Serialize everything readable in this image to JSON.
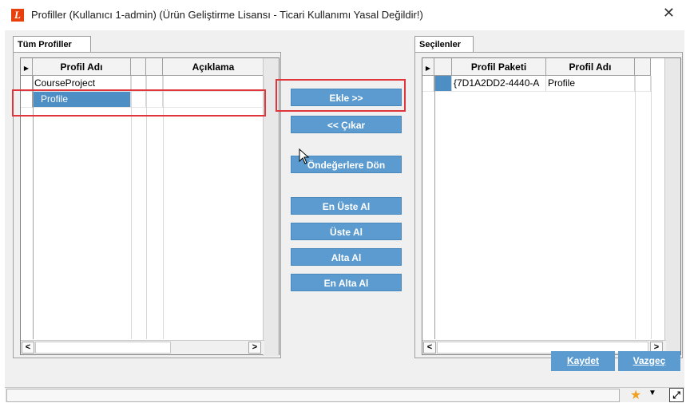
{
  "window": {
    "app_icon_letter": "L",
    "title": "Profiller (Kullanıcı 1-admin) (Ürün Geliştirme Lisansı - Ticari Kullanımı Yasal Değildir!)",
    "close_glyph": "✕"
  },
  "left_panel": {
    "tab_label": "Tüm Profiller",
    "columns": [
      "Profil Adı",
      "Açıklama"
    ],
    "rows": [
      {
        "name": "CourseProject",
        "description": ""
      },
      {
        "name": "Profile",
        "description": "",
        "selected": true
      }
    ]
  },
  "right_panel": {
    "tab_label": "Seçilenler",
    "columns": [
      "Profil Paketi",
      "Profil Adı"
    ],
    "rows": [
      {
        "package": "{7D1A2DD2-4440-A",
        "name": "Profile"
      }
    ]
  },
  "actions": {
    "add": "Ekle >>",
    "remove": "<< Çıkar",
    "reset": "Öndeğerlere Dön",
    "move_top": "En Üste Al",
    "move_up": "Üste Al",
    "move_down": "Alta Al",
    "move_bottom": "En Alta Al"
  },
  "footer": {
    "save": "Kaydet",
    "cancel": "Vazgeç"
  },
  "colors": {
    "button_blue": "#5b9bd0",
    "selection_blue": "#4d8ec4",
    "highlight_red": "#e0363b",
    "app_icon_orange": "#e8400c"
  },
  "icons": {
    "favorite": "star-icon",
    "dropdown": "chevron-down-icon",
    "expand": "expand-icon",
    "scroll_left": "chevron-left-icon",
    "scroll_right": "chevron-right-icon"
  }
}
